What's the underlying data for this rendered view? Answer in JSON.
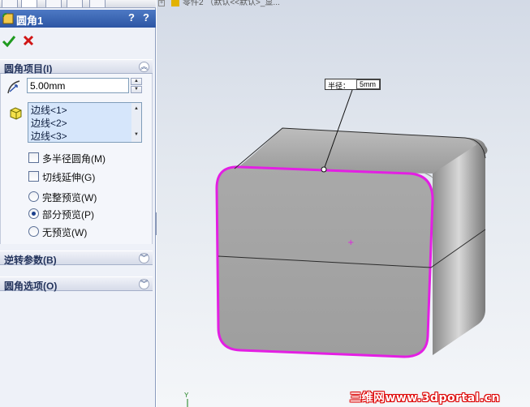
{
  "panel": {
    "title": "圆角1",
    "title_buttons": [
      "?",
      "?"
    ],
    "sections": {
      "fillet_items": {
        "title": "圆角项目(I)",
        "radius_value": "5.00mm",
        "edges": [
          "边线<1>",
          "边线<2>",
          "边线<3>"
        ],
        "options": {
          "multi_radius": "多半径圆角(M)",
          "tangent_propagation": "切线延伸(G)",
          "full_preview": "完整预览(W)",
          "partial_preview": "部分预览(P)",
          "no_preview": "无预览(W)"
        },
        "selected_preview": "partial_preview"
      },
      "setback": {
        "title": "逆转参数(B)"
      },
      "fillet_options": {
        "title": "圆角选项(O)"
      }
    }
  },
  "viewport": {
    "tree_text": "零件2 （默认<<默认>_显...",
    "callout": {
      "label": "半径：",
      "value": "5mm"
    },
    "watermark": "三维网www.3dportal.cn",
    "triad_label": "Y"
  },
  "colors": {
    "accent": "#2d56a4",
    "edge_highlight": "#e31fe3",
    "model": "#a3a3a3"
  }
}
